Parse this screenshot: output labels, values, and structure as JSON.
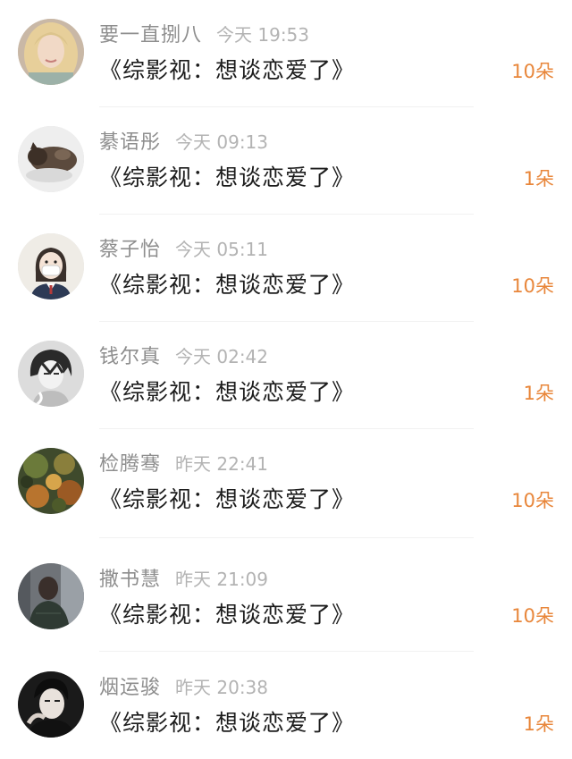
{
  "gift_list": {
    "items": [
      {
        "name": "要一直捌八",
        "time": "今天 19:53",
        "book_title": "《综影视：想谈恋爱了》",
        "flowers": "10朵",
        "avatar": "avatar-girl-blonde"
      },
      {
        "name": "綦语彤",
        "time": "今天 09:13",
        "book_title": "《综影视：想谈恋爱了》",
        "flowers": "1朵",
        "avatar": "avatar-cat-sleeping"
      },
      {
        "name": "蔡子怡",
        "time": "今天 05:11",
        "book_title": "《综影视：想谈恋爱了》",
        "flowers": "10朵",
        "avatar": "avatar-girl-mask"
      },
      {
        "name": "钱尔真",
        "time": "今天 02:42",
        "book_title": "《综影视：想谈恋爱了》",
        "flowers": "1朵",
        "avatar": "avatar-anime-boy"
      },
      {
        "name": "检腾骞",
        "time": "昨天 22:41",
        "book_title": "《综影视：想谈恋爱了》",
        "flowers": "10朵",
        "avatar": "avatar-autumn-leaves"
      },
      {
        "name": "撒书慧",
        "time": "昨天 21:09",
        "book_title": "《综影视：想谈恋爱了》",
        "flowers": "10朵",
        "avatar": "avatar-man-street"
      },
      {
        "name": "烟运骏",
        "time": "昨天 20:38",
        "book_title": "《综影视：想谈恋爱了》",
        "flowers": "1朵",
        "avatar": "avatar-man-portrait"
      }
    ]
  },
  "colors": {
    "flower_accent": "#e8863a",
    "name_text": "#8e8e8e",
    "time_text": "#b3b3b3",
    "title_text": "#1c1c1c"
  }
}
